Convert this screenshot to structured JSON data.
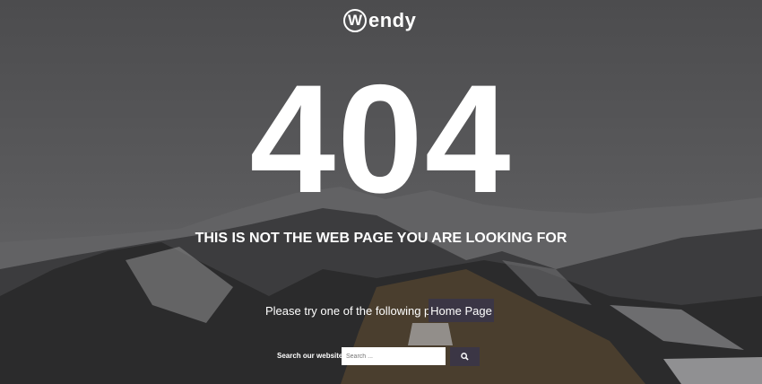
{
  "logo": {
    "initial": "W",
    "rest": "endy"
  },
  "error": {
    "code": "404",
    "headline": "THIS IS NOT THE WEB PAGE YOU ARE LOOKING FOR"
  },
  "suggest": {
    "text": "Please try one of the following pages",
    "home_label": "Home Page"
  },
  "search": {
    "label": "Search our website",
    "placeholder": "Search ...",
    "icon": "search-icon"
  }
}
